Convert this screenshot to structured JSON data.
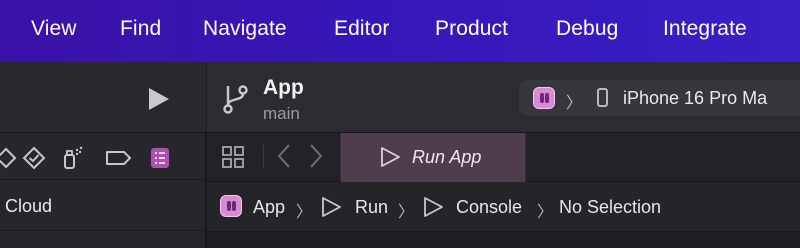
{
  "menubar": {
    "items": [
      "View",
      "Find",
      "Navigate",
      "Editor",
      "Product",
      "Debug",
      "Integrate"
    ]
  },
  "navigator": {
    "run_icon": "play-icon",
    "icons": [
      "warning-diamond-icon",
      "test-diamond-icon",
      "debug-spray-icon",
      "breakpoint-tag-icon",
      "report-list-icon"
    ],
    "cloud_label": "Cloud"
  },
  "toolbar": {
    "project_title": "App",
    "branch": "main",
    "scheme": {
      "separator": "〉",
      "device": "iPhone 16 Pro Ma"
    }
  },
  "tabbar": {
    "run_tab_label": "Run App"
  },
  "jumpbar": {
    "app": "App",
    "run": "Run",
    "console": "Console",
    "selection": "No Selection",
    "separator": "〉"
  },
  "colors": {
    "menubar_start": "#3b12a8",
    "menubar_end": "#3a1fc7",
    "accent_pink": "#d98ad4",
    "active_tab": "#4f3c4d"
  }
}
